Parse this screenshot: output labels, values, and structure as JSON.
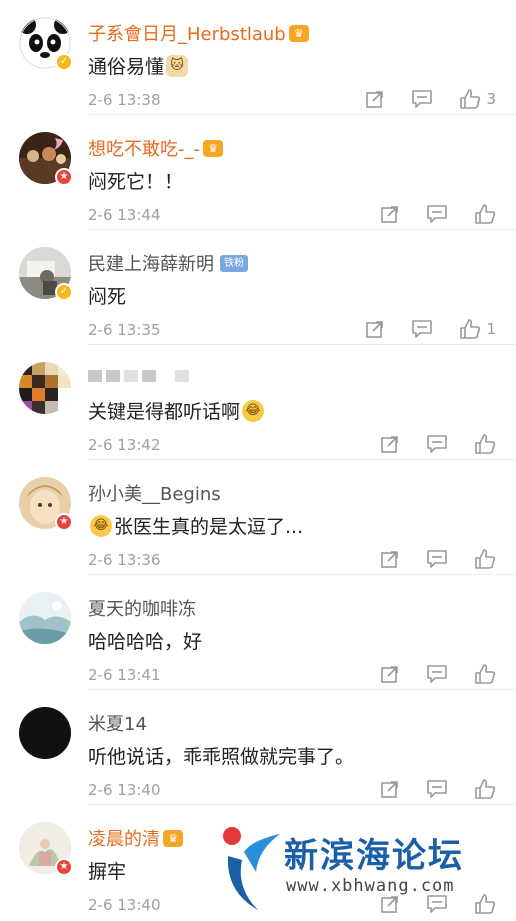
{
  "comments": [
    {
      "username": "子系會日月_Herbstlaub",
      "vip": true,
      "badge": "v",
      "text": "通俗易懂",
      "emoji_after": "cat",
      "time": "2-6 13:38",
      "like_count": "3",
      "avatar": "panda"
    },
    {
      "username": "想吃不敢吃-_-",
      "vip": true,
      "badge": "star",
      "text": "闷死它！！",
      "time": "2-6 13:44",
      "like_count": "",
      "avatar": "table"
    },
    {
      "username": "民建上海薛新明",
      "fan_tag": "铁粉",
      "badge": "v",
      "text": "闷死",
      "time": "2-6 13:35",
      "like_count": "1",
      "avatar": "car"
    },
    {
      "username": "",
      "blurred": true,
      "text": "关键是得都听话啊",
      "emoji_after": "laugh-cry",
      "time": "2-6 13:42",
      "like_count": "",
      "avatar": "mosaic"
    },
    {
      "username": "孙小美__Begins",
      "badge": "star",
      "emoji_before": "laugh-cry",
      "text": "张医生真的是太逗了...",
      "time": "2-6 13:36",
      "like_count": "",
      "avatar": "face"
    },
    {
      "username": "夏天的咖啡冻",
      "text": "哈哈哈哈，好",
      "time": "2-6 13:41",
      "like_count": "",
      "avatar": "landscape"
    },
    {
      "username": "米夏14",
      "text": "听他说话，乖乖照做就完事了。",
      "time": "2-6 13:40",
      "like_count": "",
      "avatar": "black"
    },
    {
      "username": "凌晨的清",
      "vip": true,
      "badge": "star",
      "text": "摒牢",
      "time": "2-6 13:40",
      "like_count": "",
      "avatar": "painting"
    }
  ],
  "watermark": {
    "title": "新滨海论坛",
    "url": "www.xbhwang.com"
  },
  "colors": {
    "vip_name": "#e86b1d",
    "name": "#555555",
    "meta": "#a0a0a0",
    "icon": "#9a9a9a",
    "badge_v": "#f5b920",
    "badge_star": "#e8443b"
  },
  "icons": [
    "share-icon",
    "comment-icon",
    "like-icon",
    "verified-badge-icon",
    "vip-crown-icon"
  ]
}
